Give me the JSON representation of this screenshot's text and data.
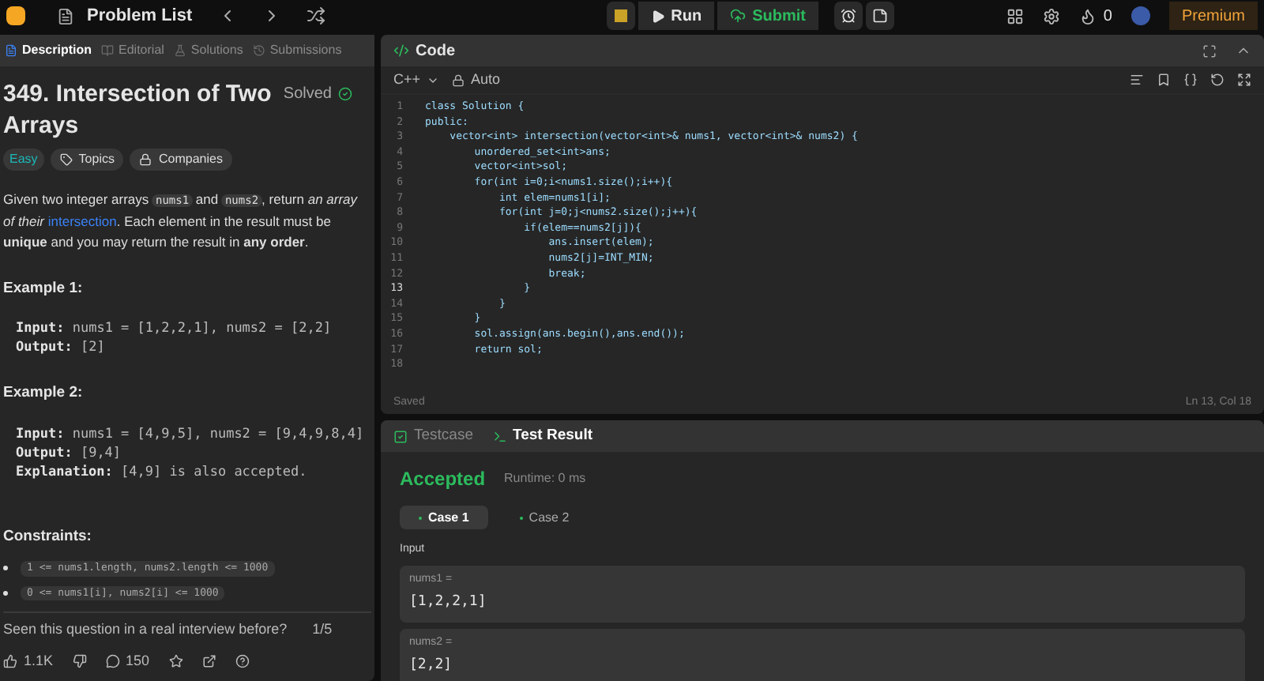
{
  "topbar": {
    "title": "Problem List",
    "run": "Run",
    "submit": "Submit",
    "streak": "0",
    "premium": "Premium"
  },
  "left_tabs": [
    {
      "label": "Description",
      "selected": true
    },
    {
      "label": "Editorial",
      "selected": false
    },
    {
      "label": "Solutions",
      "selected": false
    },
    {
      "label": "Submissions",
      "selected": false
    }
  ],
  "problem": {
    "title": "349. Intersection of Two Arrays",
    "status": "Solved",
    "solved": true,
    "tags": [
      {
        "kind": "difficulty",
        "label": "Easy"
      },
      {
        "kind": "topics",
        "label": "Topics"
      },
      {
        "kind": "companies",
        "label": "Companies"
      }
    ],
    "description": [
      {
        "kind": "text",
        "text": "Given two integer arrays "
      },
      {
        "kind": "code",
        "text": "nums1"
      },
      {
        "kind": "text",
        "text": " and "
      },
      {
        "kind": "code",
        "text": "nums2"
      },
      {
        "kind": "text",
        "text": ", return *an array of their* "
      },
      {
        "kind": "link",
        "text": "intersection"
      },
      {
        "kind": "text",
        "text": ". Each element in the result must be **unique** and you may return the result in **any order**."
      }
    ],
    "examples": [
      {
        "title": "Example 1:",
        "lines": [
          {
            "label": "Input:",
            "value": "nums1 = [1,2,2,1], nums2 = [2,2]"
          },
          {
            "label": "Output:",
            "value": "[2]"
          }
        ]
      },
      {
        "title": "Example 2:",
        "lines": [
          {
            "label": "Input:",
            "value": "nums1 = [4,9,5], nums2 = [9,4,9,8,4]"
          },
          {
            "label": "Output:",
            "value": "[9,4]"
          },
          {
            "label": "Explanation:",
            "value": "[4,9] is also accepted."
          }
        ]
      }
    ],
    "constraints_title": "Constraints:",
    "constraints": [
      "1 <= nums1.length, nums2.length <= 1000",
      "0 <= nums1[i], nums2[i] <= 1000"
    ],
    "interview_question": "Seen this question in a real interview before?",
    "interview_count": "1/5",
    "likes": "1.1K",
    "comments": "150"
  },
  "code": {
    "title": "Code",
    "language": "C++",
    "mode": "Auto",
    "status": "Saved",
    "cursor": "Ln 13, Col 18",
    "lines": [
      {
        "number": "1",
        "text": "class Solution {",
        "current": false
      },
      {
        "number": "2",
        "text": "public:",
        "current": false
      },
      {
        "number": "3",
        "text": "    vector<int> intersection(vector<int>& nums1, vector<int>& nums2) {",
        "current": false
      },
      {
        "number": "4",
        "text": "        unordered_set<int>ans;",
        "current": false
      },
      {
        "number": "5",
        "text": "        vector<int>sol;",
        "current": false
      },
      {
        "number": "6",
        "text": "        for(int i=0;i<nums1.size();i++){",
        "current": false
      },
      {
        "number": "7",
        "text": "            int elem=nums1[i];",
        "current": false
      },
      {
        "number": "8",
        "text": "            for(int j=0;j<nums2.size();j++){",
        "current": false
      },
      {
        "number": "9",
        "text": "                if(elem==nums2[j]){",
        "current": false
      },
      {
        "number": "10",
        "text": "                    ans.insert(elem);",
        "current": false
      },
      {
        "number": "11",
        "text": "                    nums2[j]=INT_MIN;",
        "current": false
      },
      {
        "number": "12",
        "text": "                    break;",
        "current": false
      },
      {
        "number": "13",
        "text": "                }",
        "current": true
      },
      {
        "number": "14",
        "text": "            }",
        "current": false
      },
      {
        "number": "15",
        "text": "        }",
        "current": false
      },
      {
        "number": "16",
        "text": "        sol.assign(ans.begin(),ans.end());",
        "current": false
      },
      {
        "number": "17",
        "text": "        return sol;",
        "current": false
      },
      {
        "number": "18",
        "current": false
      }
    ]
  },
  "result": {
    "tabs": [
      {
        "label": "Testcase",
        "selected": false
      },
      {
        "label": "Test Result",
        "selected": true
      }
    ],
    "verdict": "Accepted",
    "runtime": "Runtime: 0 ms",
    "cases": [
      {
        "label": "Case 1",
        "selected": true
      },
      {
        "label": "Case 2",
        "selected": false
      }
    ],
    "input_label": "Input",
    "inputs": [
      {
        "name": "nums1 =",
        "value": "[1,2,2,1]"
      },
      {
        "name": "nums2 =",
        "value": "[2,2]"
      }
    ]
  }
}
